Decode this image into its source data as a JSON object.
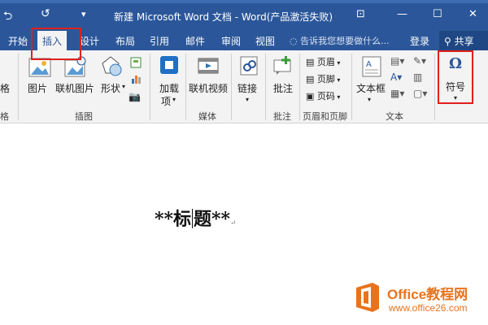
{
  "titlebar": {
    "title": "新建 Microsoft Word 文档 - Word(产品激活失败)",
    "undo_icon": "⮌",
    "redo_icon": "↺",
    "qa_menu_icon": "▾",
    "restore_ribbon_icon": "⊡",
    "minimize_icon": "—",
    "maximize_icon": "☐",
    "close_icon": "✕"
  },
  "tabs": [
    {
      "label": "开始"
    },
    {
      "label": "插入"
    },
    {
      "label": "设计"
    },
    {
      "label": "布局"
    },
    {
      "label": "引用"
    },
    {
      "label": "邮件"
    },
    {
      "label": "审阅"
    },
    {
      "label": "视图"
    }
  ],
  "tellme": "告诉我您想要做什么...",
  "login": "登录",
  "share": "共享",
  "ribbon": {
    "table_partial": "格",
    "table_group_partial": "格",
    "picture": "图片",
    "online_picture": "联机图片",
    "shapes": "形状",
    "illustration_group": "插图",
    "addin": "加载",
    "addin2": "项",
    "online_video": "联机视频",
    "media_group": "媒体",
    "link": "链接",
    "comment": "批注",
    "comment_group": "批注",
    "header": "页眉",
    "footer": "页脚",
    "page_number": "页码",
    "header_footer_group": "页眉和页脚",
    "textbox": "文本框",
    "text_group": "文本",
    "symbol": "符号",
    "omega": "Ω"
  },
  "document": {
    "text_before": "**标",
    "text_after": "题**",
    "para_mark": "↵"
  },
  "watermark": {
    "title": "Office教程网",
    "url": "www.office26.com"
  },
  "colors": {
    "titlebar": "#2b579a",
    "highlight": "#e0201b",
    "watermark": "#e8731c"
  }
}
